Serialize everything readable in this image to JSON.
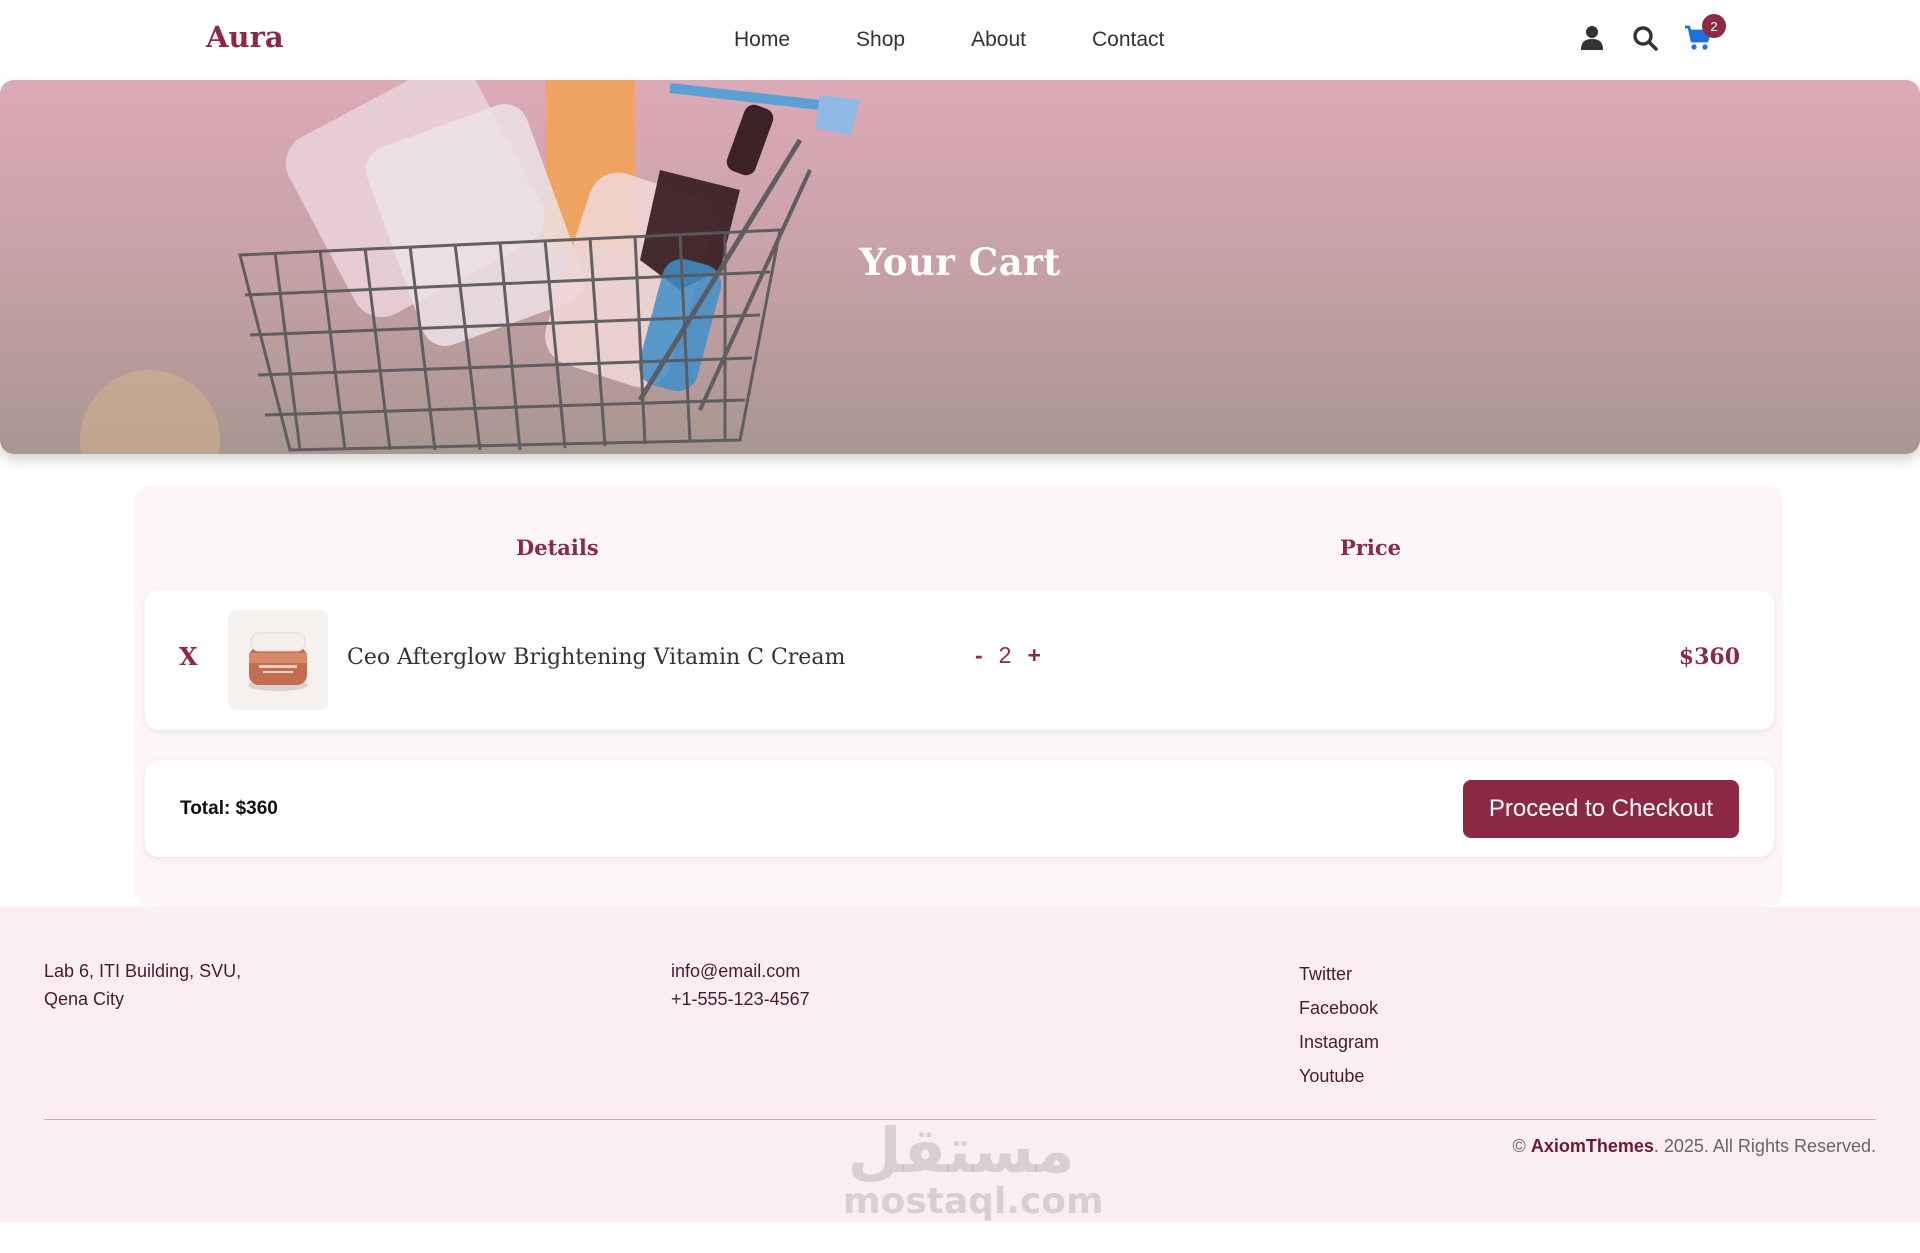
{
  "header": {
    "brand": "Aura",
    "nav": [
      "Home",
      "Shop",
      "About",
      "Contact"
    ],
    "cart_count": "2"
  },
  "hero": {
    "title": "Your Cart"
  },
  "cart": {
    "columns": {
      "details": "Details",
      "price": "Price"
    },
    "items": [
      {
        "remove_label": "X",
        "name": "Ceo Afterglow Brightening Vitamin C Cream",
        "qty_minus": "-",
        "quantity": "2",
        "qty_plus": "+",
        "price": "$360"
      }
    ],
    "total_label": "Total: $360",
    "checkout_label": "Proceed to Checkout"
  },
  "footer": {
    "address_line1": "Lab 6, ITI Building, SVU,",
    "address_line2": "Qena City",
    "email": "info@email.com",
    "phone": "+1-555-123-4567",
    "social": [
      "Twitter",
      "Facebook",
      "Instagram",
      "Youtube"
    ],
    "copyright_prefix": "©",
    "copyright_brand": "AxiomThemes",
    "copyright_suffix": ". 2025. All Rights Reserved."
  },
  "watermark": {
    "arabic": "مستقل",
    "latin": "mostaql.com"
  },
  "colors": {
    "accent": "#8c2a45",
    "footer_bg": "#fbeef2",
    "panel_bg": "#fdf6f8"
  }
}
